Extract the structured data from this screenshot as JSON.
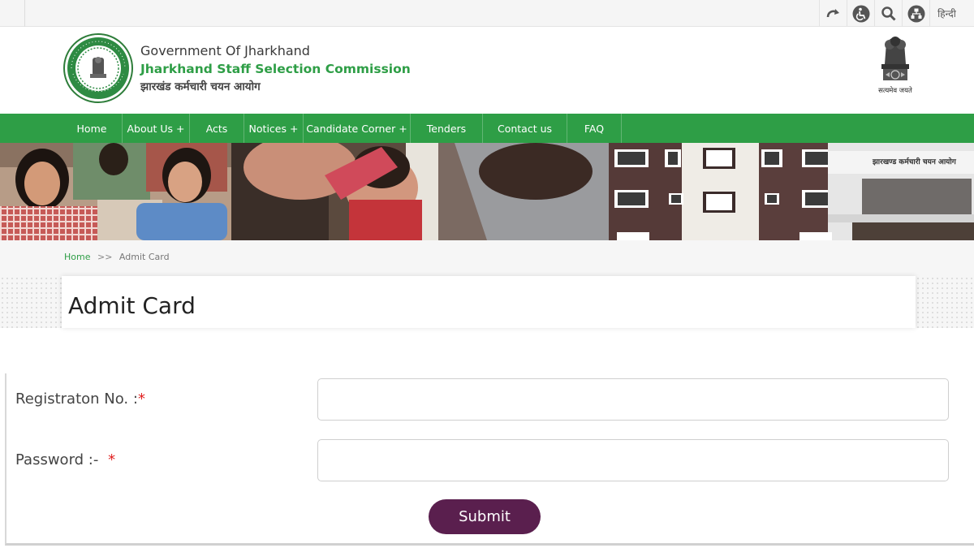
{
  "utility": {
    "icons": [
      "refresh-icon",
      "accessibility-icon",
      "search-icon",
      "sitemap-icon"
    ],
    "language_label": "हिन्दी"
  },
  "header": {
    "org_line": "Government Of Jharkhand",
    "commission_name": "Jharkhand Staff Selection Commission",
    "commission_hindi": "झारखंड कर्मचारी चयन आयोग",
    "emblem_motto": "सत्यमेव जयते",
    "logo_ring_text": "GOVERNMENT OF JHARKHAND"
  },
  "nav": {
    "items": [
      {
        "label": "Home"
      },
      {
        "label": "About Us +"
      },
      {
        "label": "Acts"
      },
      {
        "label": "Notices +"
      },
      {
        "label": "Candidate Corner +"
      },
      {
        "label": "Tenders"
      },
      {
        "label": "Contact us"
      },
      {
        "label": "FAQ"
      }
    ]
  },
  "banner": {
    "building_sign": "झारखण्ड कर्मचारी चयन आयोग"
  },
  "breadcrumb": {
    "home": "Home",
    "separator": ">>",
    "current": "Admit Card"
  },
  "page": {
    "title": "Admit Card"
  },
  "form": {
    "registration_label": "Registraton No. :",
    "registration_required": "*",
    "registration_value": "",
    "password_label": "Password :- ",
    "password_required": "*",
    "password_value": "",
    "submit_label": "Submit"
  },
  "colors": {
    "brand_green": "#2e9e46",
    "submit_purple": "#5a1f4e",
    "required_red": "#e02020"
  }
}
